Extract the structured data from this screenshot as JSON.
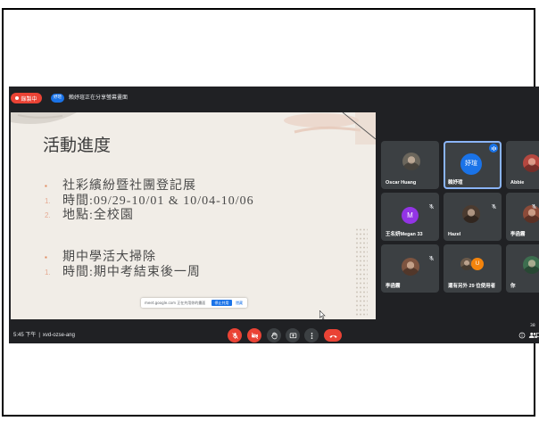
{
  "meeting": {
    "recording_label": "錄製中",
    "presenter_avatar": "妤瑄",
    "presenting_text": "賴妤瑄正在分享螢幕畫面",
    "time": "5:45 下午",
    "separator": "|",
    "meeting_code": "xvd-ozse-ang",
    "people_count": "38"
  },
  "slide": {
    "title": "活動進度",
    "items": [
      {
        "marker": "▪",
        "text": "社彩繽紛暨社團登記展"
      },
      {
        "marker": "1.",
        "text": "時間:09/29-10/01 & 10/04-10/06"
      },
      {
        "marker": "2.",
        "text": "地點:全校園"
      },
      {
        "marker": "▪",
        "text": "期中學活大掃除"
      },
      {
        "marker": "1.",
        "text": "時間:期中考結束後一周"
      }
    ]
  },
  "share_bar": {
    "message": "meet.google.com 正在共用你的畫面",
    "stop_label": "停止共用",
    "hide_label": "隱藏"
  },
  "participants": [
    {
      "name": "Oscar Huang",
      "avatar": "photo",
      "avatar_color": "#6b665c",
      "muted": false
    },
    {
      "name": "賴妤瑄",
      "avatar_initial": "妤瑄",
      "avatar_color": "#1a73e8",
      "speaking": true
    },
    {
      "name": "Abbie",
      "avatar": "photo",
      "avatar_color": "#b5473f",
      "muted": false
    },
    {
      "name": "王名妍Megan 33",
      "avatar_initial": "M",
      "avatar_color": "#9334e6",
      "muted": true
    },
    {
      "name": "Hazel",
      "avatar": "photo",
      "avatar_color": "#4b3b30",
      "muted": true
    },
    {
      "name": "李函霧",
      "avatar": "photo",
      "avatar_color": "#8c4b39",
      "muted": true
    },
    {
      "name": "李函霧",
      "avatar": "photo",
      "avatar_color": "#7d5440",
      "muted": true
    },
    {
      "name": "還有另外 29 位使用者",
      "avatar": "photo",
      "avatar_color": "#6b5a4a",
      "extra_initial": "U",
      "extra_color": "#f4840c",
      "muted": true
    },
    {
      "name": "你",
      "avatar": "photo",
      "avatar_color": "#3d6e4f",
      "muted": false
    }
  ],
  "controls": {
    "mic": {
      "icon": "mic-off-icon",
      "color": "#ea4335"
    },
    "camera": {
      "icon": "camera-off-icon",
      "color": "#ea4335"
    },
    "hand": {
      "icon": "raise-hand-icon",
      "color": "#3c4043"
    },
    "present": {
      "icon": "present-icon",
      "color": "#3c4043"
    },
    "more": {
      "icon": "more-options-icon",
      "color": "#3c4043"
    },
    "end_call": {
      "icon": "end-call-icon",
      "color": "#ea4335"
    }
  },
  "toolbar_right": {
    "info": "info-icon",
    "people": "people-icon",
    "chat": "chat-icon"
  },
  "colors": {
    "background": "#202124",
    "tile": "#3c4043",
    "accent": "#1a73e8",
    "active_border": "#8ab4f8",
    "recording": "#ea4335",
    "slide": "#f1ede7"
  }
}
